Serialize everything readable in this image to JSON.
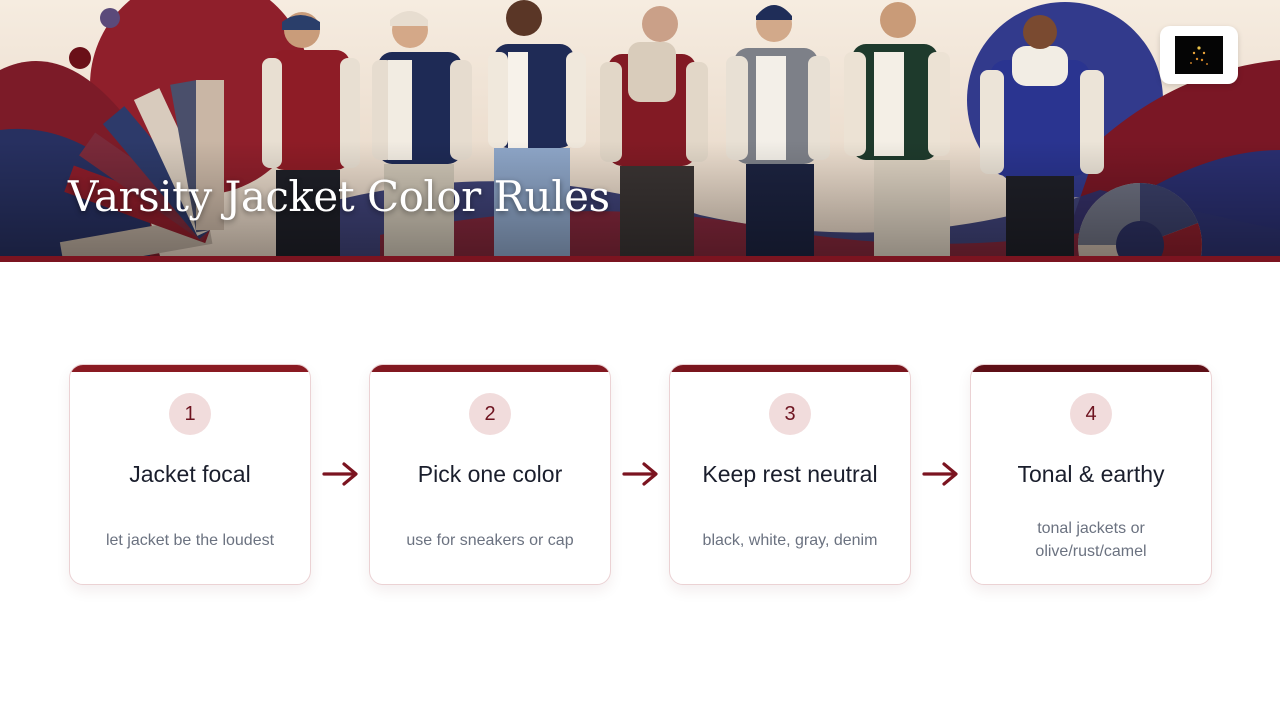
{
  "title": "Varsity Jacket Color Rules",
  "hero_image": "illustration of seven young men in varsity jackets over a maroon, navy and cream abstract background with color swatches",
  "logo_icon": "sparkle-logo-icon",
  "colors": {
    "accent": "#7b1420",
    "badge_bg": "#f1dcdc",
    "badge_text": "#6e1420",
    "title_text": "#1a1e2c",
    "desc_text": "#6b7280",
    "card_border": "#ebd2d4"
  },
  "steps": [
    {
      "number": "1",
      "title": "Jacket focal",
      "lines": [
        "let jacket be the loudest"
      ],
      "top_color": "#8a1a22"
    },
    {
      "number": "2",
      "title": "Pick one color",
      "lines": [
        "use for sneakers or cap"
      ],
      "top_color": "#821820"
    },
    {
      "number": "3",
      "title": "Keep rest neutral",
      "lines": [
        "black, white, gray, denim"
      ],
      "top_color": "#7a151d"
    },
    {
      "number": "4",
      "title": "Tonal & earthy",
      "lines": [
        "tonal jackets or",
        "olive/rust/camel"
      ],
      "top_color": "#5e0f16"
    }
  ],
  "arrow_icon": "arrow-right-icon"
}
